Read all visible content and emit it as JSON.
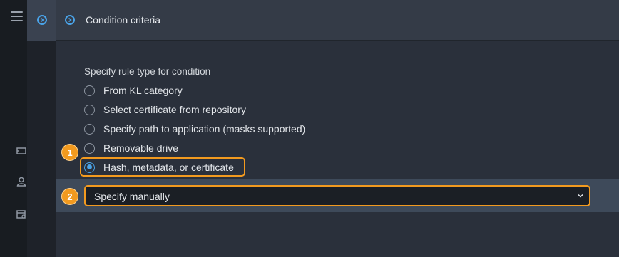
{
  "header": {
    "title": "Condition criteria"
  },
  "icons": {
    "menu": "menu-icon",
    "expand": "chevron-right-circle-icon",
    "list": "list-icon",
    "user": "user-icon",
    "settings": "settings-window-icon",
    "dropdown": "chevron-down-icon"
  },
  "form": {
    "label": "Specify rule type for condition",
    "options": [
      {
        "label": "From KL category",
        "checked": false
      },
      {
        "label": "Select certificate from repository",
        "checked": false
      },
      {
        "label": "Specify path to application (masks supported)",
        "checked": false
      },
      {
        "label": "Removable drive",
        "checked": false
      },
      {
        "label": "Hash, metadata, or certificate",
        "checked": true
      }
    ],
    "select": {
      "value": "Specify manually"
    }
  },
  "callouts": [
    "1",
    "2"
  ],
  "colors": {
    "accent": "#4aa3e8",
    "callout": "#f29a1f",
    "header_bg": "#343b47",
    "content_bg": "#2a303b"
  }
}
